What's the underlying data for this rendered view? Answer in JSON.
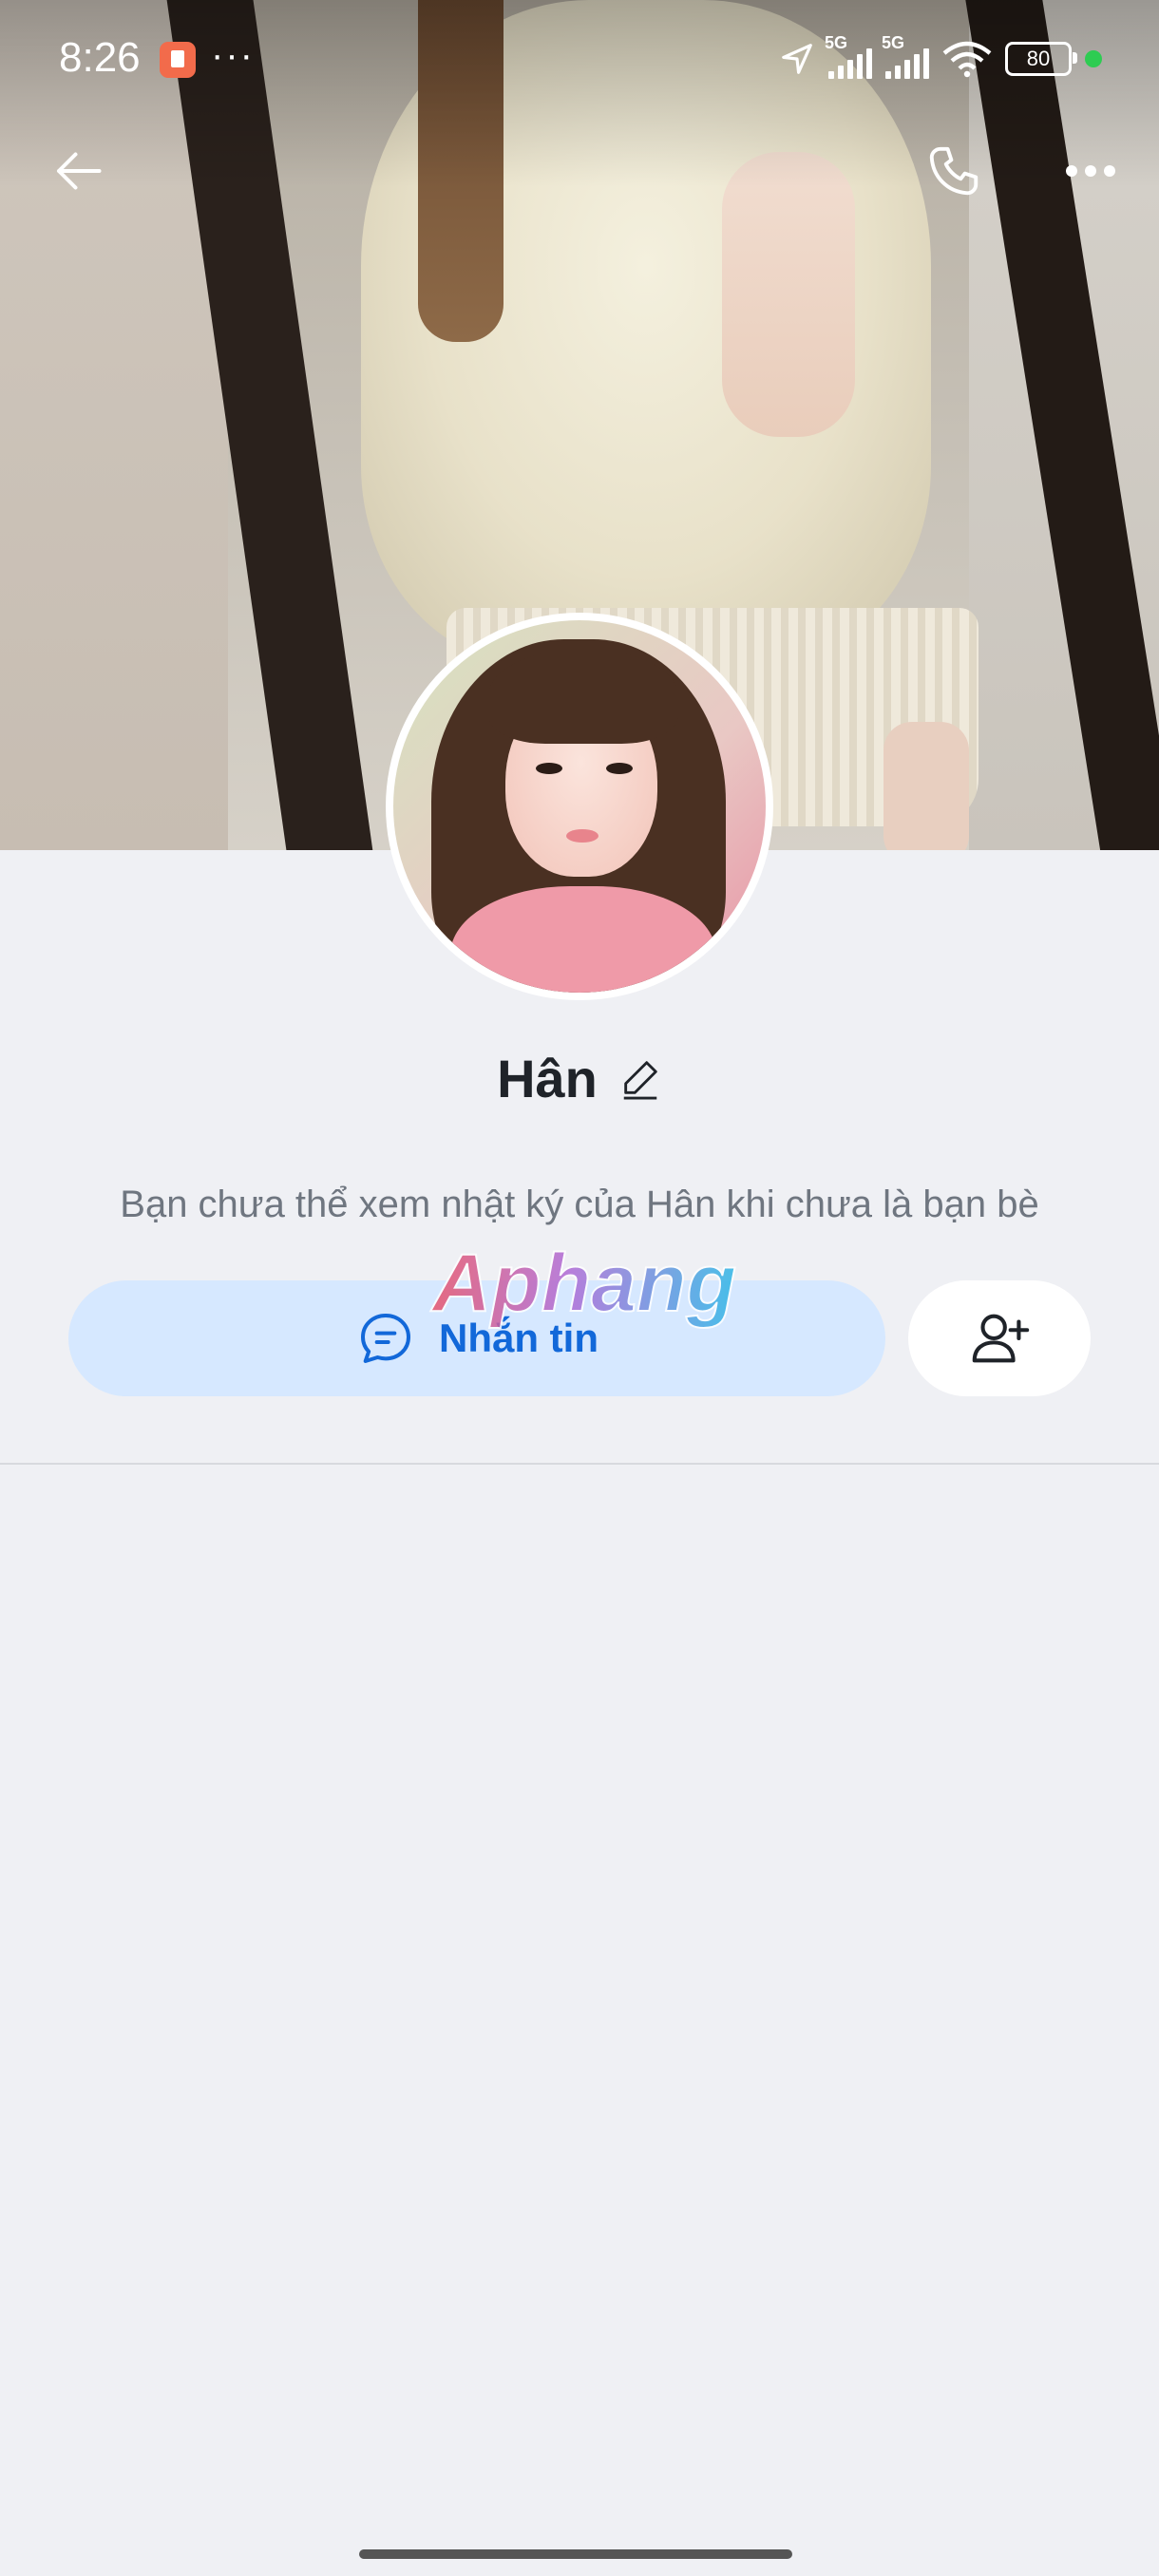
{
  "status_bar": {
    "time": "8:26",
    "dots": "···",
    "network_1": "5G",
    "network_2": "5G",
    "battery": "80"
  },
  "toolbar": {
    "back_icon": "arrow-left-icon",
    "call_icon": "phone-icon",
    "more_icon": "more-horizontal-icon"
  },
  "profile": {
    "name": "Hân",
    "edit_icon": "pencil-icon",
    "info": "Bạn chưa thể xem nhật ký của Hân khi chưa là bạn bè"
  },
  "actions": {
    "message_label": "Nhắn tin",
    "message_icon": "chat-bubble-icon",
    "add_friend_icon": "add-user-icon"
  },
  "watermark": {
    "text": "Aphang"
  },
  "colors": {
    "accent": "#1268d9",
    "message_button_bg": "#d6e8ff",
    "page_bg": "#eff0f4"
  }
}
